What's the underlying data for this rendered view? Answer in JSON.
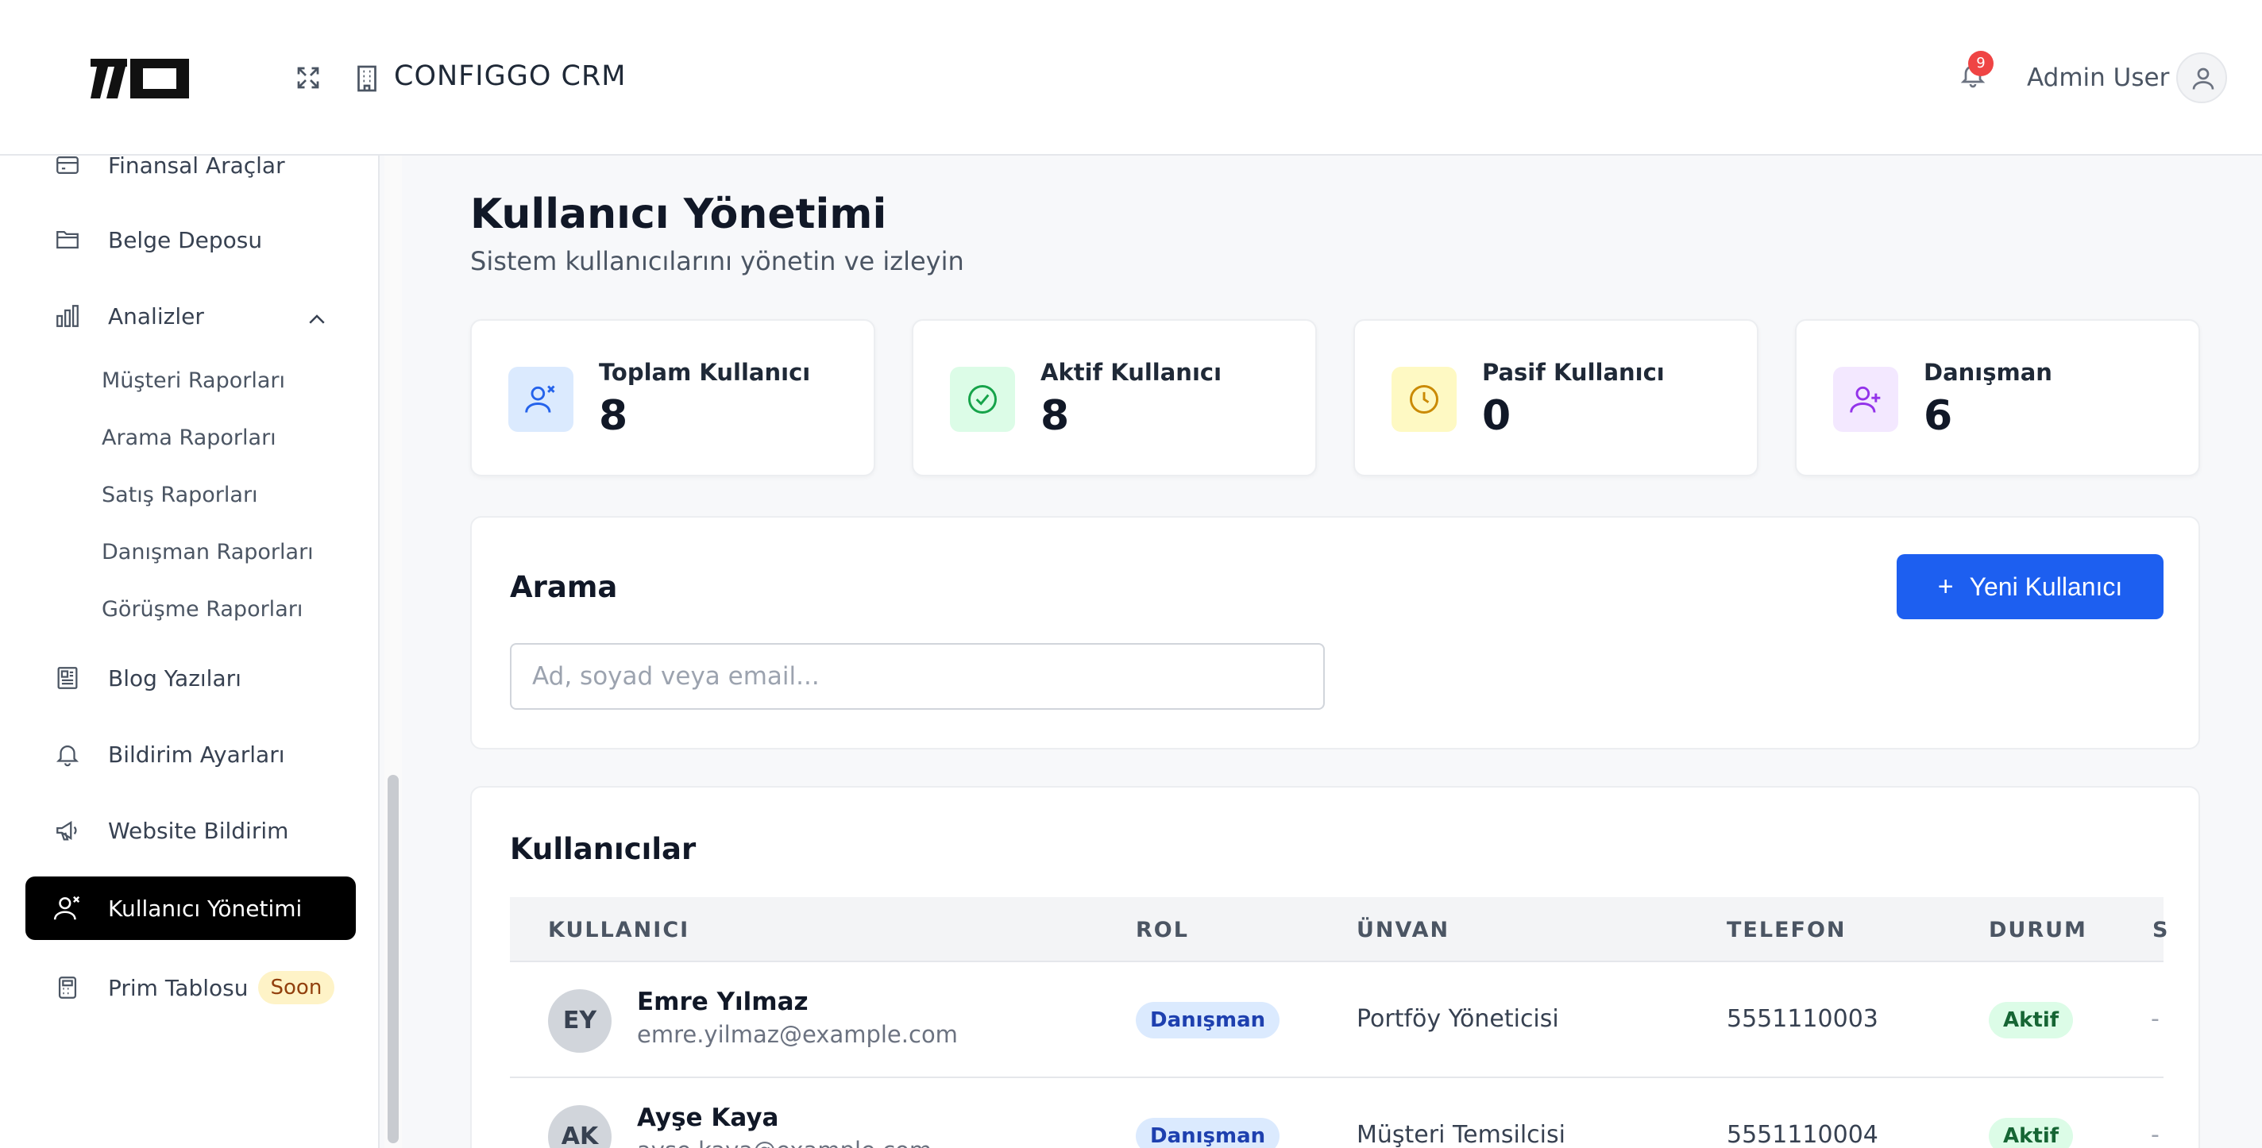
{
  "header": {
    "app_title": "CONFIGGO  CRM",
    "notification_count": "9",
    "user_name": "Admin User"
  },
  "sidebar": {
    "items": [
      {
        "label": "Finansal Araçlar",
        "icon": "credit-card-icon"
      },
      {
        "label": "Belge Deposu",
        "icon": "folder-icon"
      },
      {
        "label": "Analizler",
        "icon": "bar-chart-icon"
      },
      {
        "label": "Blog Yazıları",
        "icon": "newspaper-icon"
      },
      {
        "label": "Bildirim Ayarları",
        "icon": "bell-icon"
      },
      {
        "label": "Website Bildirim",
        "icon": "megaphone-icon"
      },
      {
        "label": "Kullanıcı Yönetimi",
        "icon": "users-icon"
      },
      {
        "label": "Prim Tablosu",
        "icon": "calculator-icon",
        "badge": "Soon"
      }
    ],
    "analytics_sub": [
      "Müşteri Raporları",
      "Arama Raporları",
      "Satış Raporları",
      "Danışman Raporları",
      "Görüşme Raporları"
    ]
  },
  "page": {
    "title": "Kullanıcı Yönetimi",
    "subtitle": "Sistem kullanıcılarını yönetin ve izleyin"
  },
  "stats": [
    {
      "label": "Toplam Kullanıcı",
      "value": "8",
      "color": "#2563eb"
    },
    {
      "label": "Aktif Kullanıcı",
      "value": "8",
      "color": "#16a34a"
    },
    {
      "label": "Pasif Kullanıcı",
      "value": "0",
      "color": "#ca8a04"
    },
    {
      "label": "Danışman",
      "value": "6",
      "color": "#9333ea"
    }
  ],
  "search": {
    "title": "Arama",
    "placeholder": "Ad, soyad veya email...",
    "new_user_label": "Yeni Kullanıcı"
  },
  "users_table": {
    "title": "Kullanıcılar",
    "columns": [
      "KULLANICI",
      "ROL",
      "ÜNVAN",
      "TELEFON",
      "DURUM",
      "S"
    ],
    "rows": [
      {
        "initials": "EY",
        "name": "Emre Yılmaz",
        "email": "emre.yilmaz@example.com",
        "role": "Danışman",
        "title": "Portföy Yöneticisi",
        "phone": "5551110003",
        "status": "Aktif",
        "extra": "-"
      },
      {
        "initials": "AK",
        "name": "Ayşe Kaya",
        "email": "ayse.kaya@example.com",
        "role": "Danışman",
        "title": "Müşteri Temsilcisi",
        "phone": "5551110004",
        "status": "Aktif",
        "extra": "-"
      }
    ]
  },
  "colors": {
    "accent": "#1d5ff0",
    "active_nav": "#000000",
    "badge_red": "#ef4444"
  }
}
